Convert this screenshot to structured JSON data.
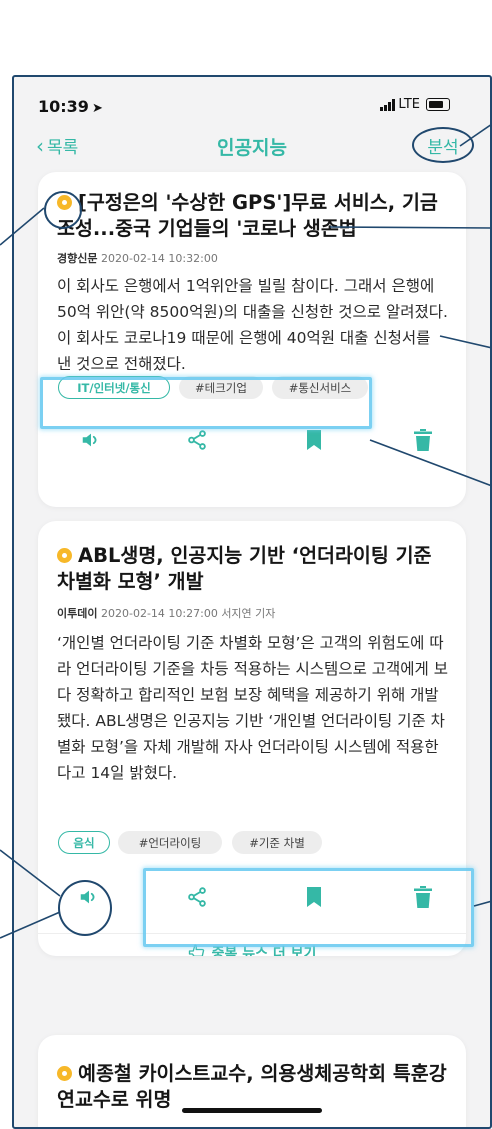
{
  "status": {
    "time": "10:39",
    "network": "LTE"
  },
  "nav": {
    "back_label": "목록",
    "title": "인공지능",
    "action_label": "분석"
  },
  "articles": [
    {
      "title": "[구정은의 '수상한 GPS']무료 서비스, 기금 조성...중국 기업들의 '코로나 생존법",
      "source": "경향신문",
      "datetime": "2020-02-14 10:32:00",
      "author": "",
      "summary": "이 회사도 은행에서 1억위안을 빌릴 참이다. 그래서 은행에 50억 위안(약 8500억원)의 대출을 신청한 것으로 알려졌다. 이 회사도 코로나19 때문에 은행에 40억원 대출 신청서를 낸 것으로 전해졌다.",
      "category": "IT/인터넷/통신",
      "tags": [
        "#테크기업",
        "#통신서비스"
      ]
    },
    {
      "title": "ABL생명, 인공지능 기반 ‘언더라이팅 기준 차별화 모형’ 개발",
      "source": "이투데이",
      "datetime": "2020-02-14 10:27:00",
      "author": "서지연 기자",
      "summary": "‘개인별 언더라이팅 기준 차별화 모형’은 고객의 위험도에 따라 언더라이팅 기준을 차등 적용하는 시스템으로 고객에게 보다 정확하고 합리적인 보험 보장 혜택을 제공하기 위해 개발됐다. ABL생명은 인공지능 기반 ‘개인별 언더라이팅 기준 차별화 모형’을 자체 개발해 자사 언더라이팅 시스템에 적용한다고 14일 밝혔다.",
      "category": "음식",
      "tags": [
        "#언더라이팅",
        "#기준 차별"
      ],
      "more_label": "중복 뉴스 더 보기"
    },
    {
      "title": "예종철 카이스트교수, 의용생체공학회 특훈강연교수로 위명"
    }
  ],
  "icons": {
    "back": "chevron-left-icon",
    "speaker": "speaker-icon",
    "share": "share-icon",
    "bookmark": "bookmark-icon",
    "delete": "trash-icon",
    "more": "hand-pointer-icon",
    "location": "location-arrow-icon",
    "signal": "signal-bars-icon",
    "battery": "battery-icon"
  },
  "colors": {
    "accent": "#35b8a6",
    "bullet": "#f7b829",
    "annotation_line": "#20486e",
    "annotation_highlight": "#64c8f0"
  }
}
